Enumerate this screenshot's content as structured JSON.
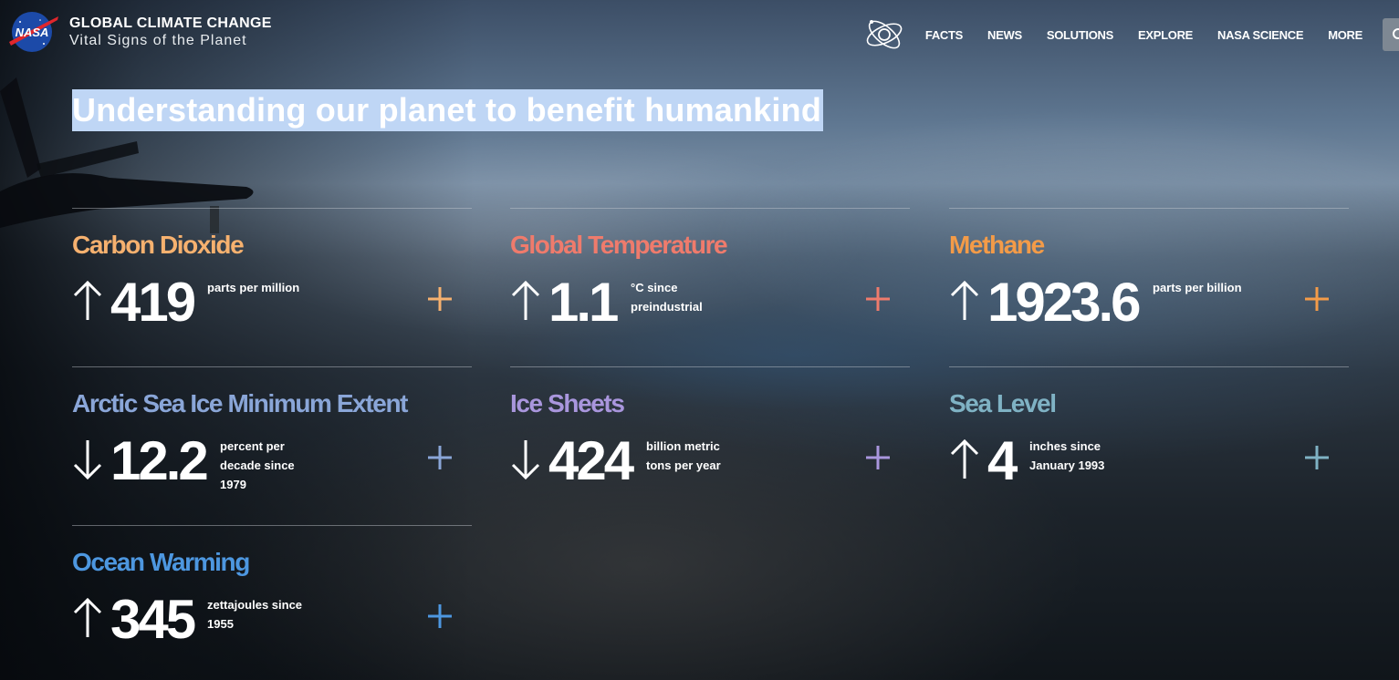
{
  "header": {
    "brand_title": "GLOBAL CLIMATE CHANGE",
    "brand_subtitle": "Vital Signs of the Planet",
    "logo_text": "NASA",
    "nav": [
      "FACTS",
      "NEWS",
      "SOLUTIONS",
      "EXPLORE",
      "NASA SCIENCE",
      "MORE"
    ]
  },
  "headline": "Understanding our planet to benefit humankind",
  "indicators": [
    {
      "title": "Carbon Dioxide",
      "value": "419",
      "unit": "parts per million",
      "trend": "up",
      "color": "#f6b16f"
    },
    {
      "title": "Global Temperature",
      "value": "1.1",
      "unit": "°C since preindustrial",
      "trend": "up",
      "color": "#ef7b6c"
    },
    {
      "title": "Methane",
      "value": "1923.6",
      "unit": "parts per billion",
      "trend": "up",
      "color": "#f39b48"
    },
    {
      "title": "Arctic Sea Ice Minimum Extent",
      "value": "12.2",
      "unit": "percent per decade since 1979",
      "trend": "down",
      "color": "#8aa6d8"
    },
    {
      "title": "Ice Sheets",
      "value": "424",
      "unit": "billion metric tons per year",
      "trend": "down",
      "color": "#a996dd"
    },
    {
      "title": "Sea Level",
      "value": "4",
      "unit": "inches since January 1993",
      "trend": "up",
      "color": "#7fb2c4"
    },
    {
      "title": "Ocean Warming",
      "value": "345",
      "unit": "zettajoules since 1955",
      "trend": "up",
      "color": "#4d97e0"
    }
  ]
}
